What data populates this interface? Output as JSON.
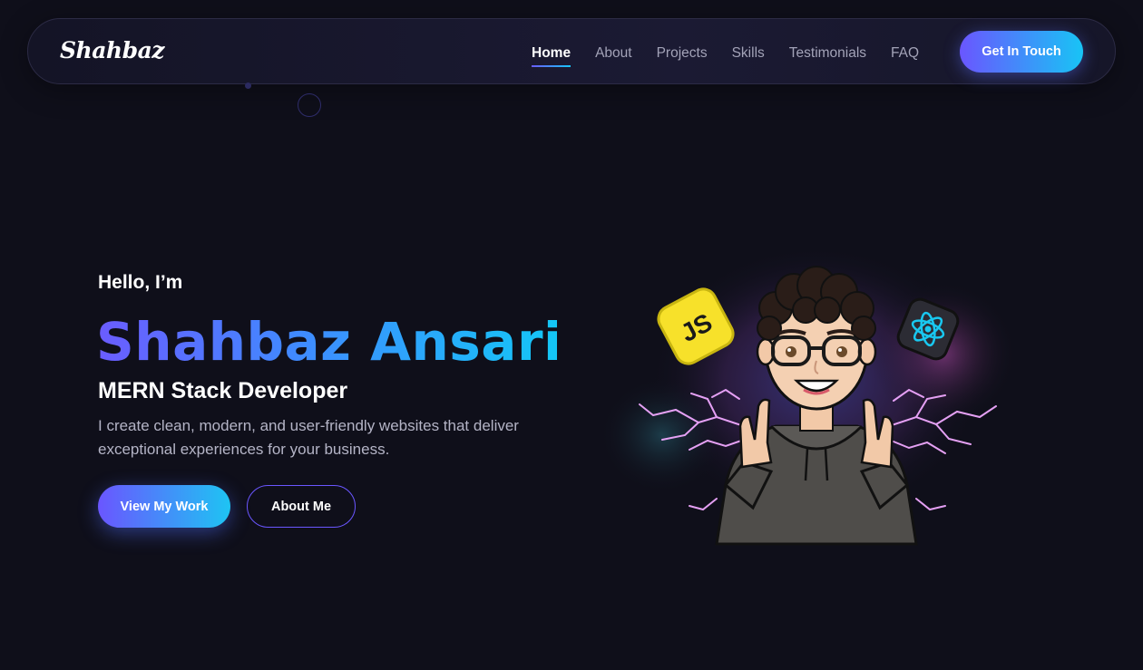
{
  "brand": {
    "logo_text": "Shahbaz"
  },
  "nav": {
    "links": [
      {
        "label": "Home",
        "active": true
      },
      {
        "label": "About",
        "active": false
      },
      {
        "label": "Projects",
        "active": false
      },
      {
        "label": "Skills",
        "active": false
      },
      {
        "label": "Testimonials",
        "active": false
      },
      {
        "label": "FAQ",
        "active": false
      }
    ],
    "cta_label": "Get In Touch"
  },
  "hero": {
    "greeting": "Hello, I’m",
    "name": "Shahbaz Ansari",
    "role": "MERN Stack Developer",
    "description": "I create clean, modern, and user-friendly websites that deliver exceptional experiences for your business.",
    "primary_button": "View My Work",
    "secondary_button": "About Me"
  },
  "illustration": {
    "badge_left_text": "JS",
    "badge_right_icon": "react-icon",
    "avatar_icon": "developer-avatar-icon"
  },
  "colors": {
    "background": "#0f0f1a",
    "accent_start": "#6a56ff",
    "accent_end": "#18c4f5",
    "muted_text": "#a3a3b8"
  }
}
